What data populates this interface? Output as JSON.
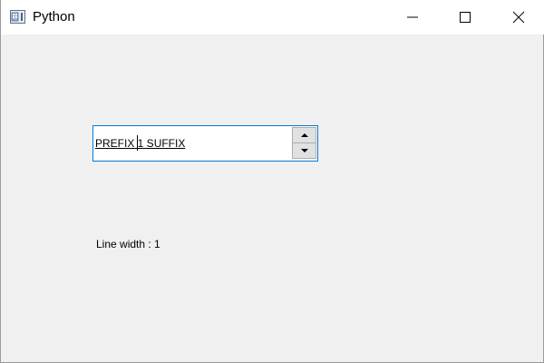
{
  "window": {
    "title": "Python",
    "icon": "python-app-icon"
  },
  "controls": {
    "minimize_icon": "minimize-icon",
    "maximize_icon": "maximize-icon",
    "close_icon": "close-icon"
  },
  "spinbox": {
    "prefix": "PREFIX ",
    "value": "1",
    "suffix": " SUFFIX",
    "display": "PREFIX 1 SUFFIX",
    "accent_color": "#0078d7",
    "up_icon": "triangle-up-icon",
    "down_icon": "triangle-down-icon"
  },
  "label": {
    "text": "Line width : 1"
  }
}
